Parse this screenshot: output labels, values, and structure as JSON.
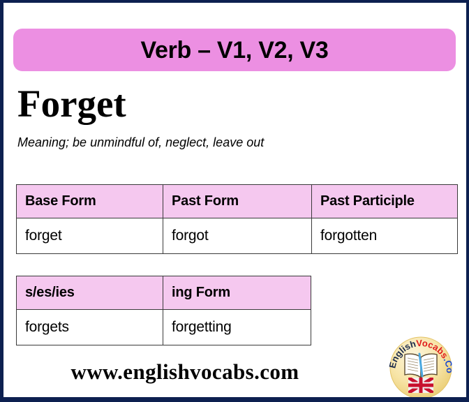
{
  "page": {
    "border_color": "#0d2050",
    "background": "#ffffff"
  },
  "banner": {
    "text": "Verb – V1, V2, V3",
    "background": "#ec8fe2"
  },
  "word": {
    "title": "Forget",
    "meaning_line": "Meaning; be unmindful of, neglect, leave out"
  },
  "tables": {
    "forms": {
      "header_background": "#f5c8ef",
      "headers": [
        "Base Form",
        "Past Form",
        "Past Participle"
      ],
      "rows": [
        [
          "forget",
          "forgot",
          "forgotten"
        ]
      ]
    },
    "extra": {
      "header_background": "#f5c8ef",
      "headers": [
        "s/es/ies",
        "ing Form"
      ],
      "rows": [
        [
          "forgets",
          "forgetting"
        ]
      ]
    }
  },
  "footer": {
    "site_url": "www.englishvocabs.com"
  },
  "logo": {
    "name": "englishvocabs-logo",
    "text_part_1": "English",
    "text_part_2": "Vocabs",
    "text_part_3": ".Com",
    "color_part_1": "#1b2a4a",
    "color_part_2": "#e01b1b",
    "color_part_3": "#1b4ad0",
    "badge_color": "#f6e3a8",
    "icons": [
      "open-book-icon",
      "uk-flag-icon"
    ]
  }
}
